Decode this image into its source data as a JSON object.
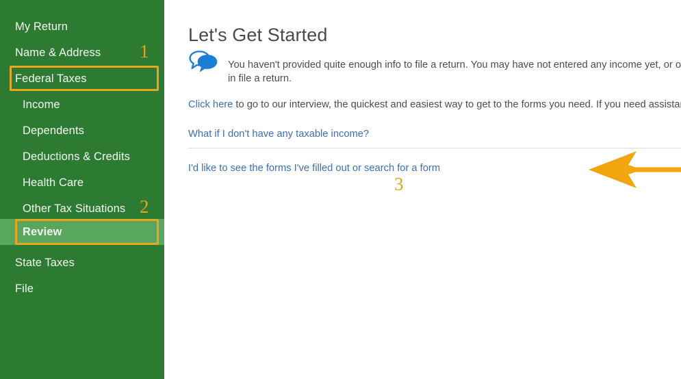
{
  "window": {
    "title": "Let's Get Started"
  },
  "colors": {
    "sidebar_bg": "#2d7b32",
    "sidebar_active_bg": "#59a65e",
    "sidebar_accent": "#49dd5c",
    "annotation_orange": "#eda51e",
    "link_blue": "#3d6fb5",
    "icon_blue": "#1a7fd4",
    "body_text": "#4c4c4c",
    "divider": "#d9dde3"
  },
  "sidebar": {
    "items": [
      {
        "label": "My Return",
        "level": 1,
        "active": false
      },
      {
        "label": "Name & Address",
        "level": 1,
        "active": false
      },
      {
        "label": "Federal Taxes",
        "level": 1,
        "active": false
      },
      {
        "label": "Income",
        "level": 2,
        "active": false
      },
      {
        "label": "Dependents",
        "level": 2,
        "active": false
      },
      {
        "label": "Deductions & Credits",
        "level": 2,
        "active": false
      },
      {
        "label": "Health Care",
        "level": 2,
        "active": false
      },
      {
        "label": "Other Tax Situations",
        "level": 2,
        "active": false
      },
      {
        "label": "Review",
        "level": 2,
        "active": true
      },
      {
        "label": "State Taxes",
        "level": 1,
        "active": false
      },
      {
        "label": "File",
        "level": 1,
        "active": false
      }
    ]
  },
  "annotations": {
    "step_1": "1",
    "step_2": "2",
    "step_3": "3",
    "boxed_items": [
      "Federal Taxes",
      "Review"
    ],
    "arrow_icon": "left-arrow-icon",
    "arrow_target": "I'd like to see the forms I've filled out or search for a form"
  },
  "main": {
    "title": "Let's Get Started",
    "notice": {
      "icon": "chat-bubble-icon",
      "text": "You haven't provided quite enough info to file a return. You may have not entered any income yet, or other in file a return."
    },
    "click_here_line": {
      "link_text": "Click here",
      "rest_text": " to go to our interview, the quickest and easiest way to get to the forms you need. If you need assistance, just"
    },
    "taxable_income_link": "What if I don't have any taxable income?",
    "see_forms_link": "I'd like to see the forms I've filled out or search for a form"
  }
}
